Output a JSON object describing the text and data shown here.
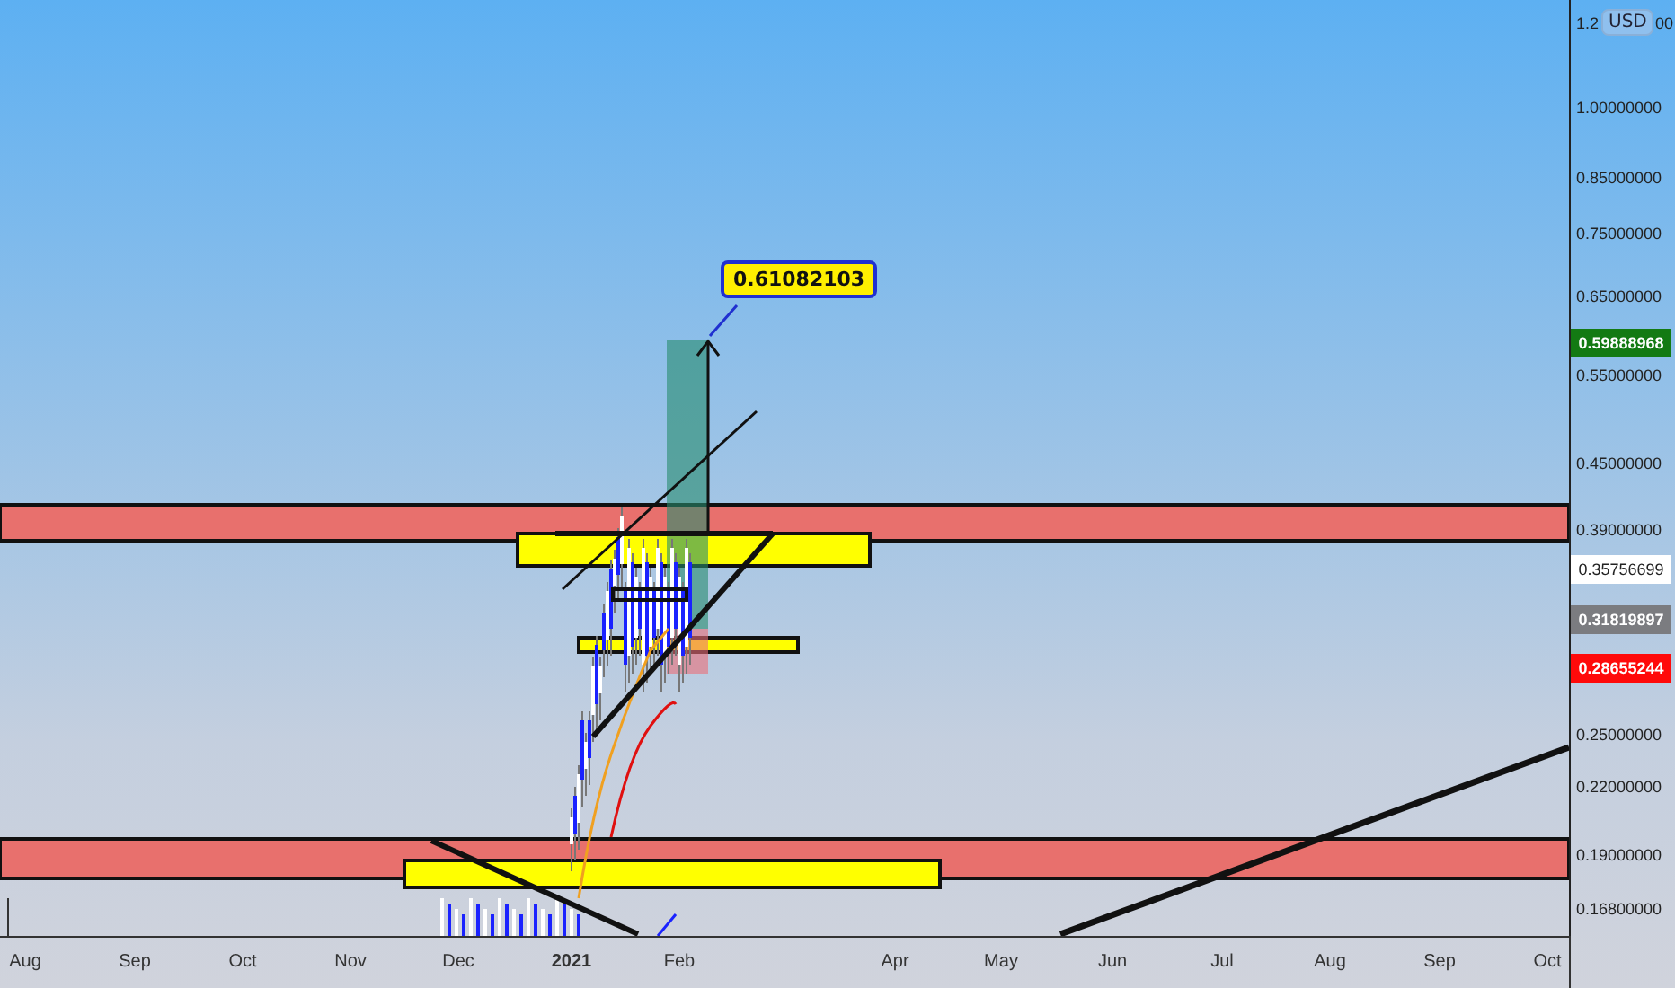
{
  "chart": {
    "target_callout": "0.61082103"
  },
  "price_axis": {
    "currency": "USD",
    "top_tick_parts": [
      "1.2",
      "00"
    ],
    "ticks": [
      "1.00000000",
      "0.85000000",
      "0.75000000",
      "0.65000000",
      "0.55000000",
      "0.45000000",
      "0.39000000",
      "0.25000000",
      "0.22000000",
      "0.19000000",
      "0.16800000"
    ],
    "labels": [
      {
        "text": "0.59888968",
        "kind": "target"
      },
      {
        "text": "0.35756699",
        "kind": "last"
      },
      {
        "text": "0.31819897",
        "kind": "entry"
      },
      {
        "text": "0.28655244",
        "kind": "stop"
      }
    ]
  },
  "time_axis": {
    "labels": [
      {
        "text": "Aug",
        "bold": false
      },
      {
        "text": "Sep",
        "bold": false
      },
      {
        "text": "Oct",
        "bold": false
      },
      {
        "text": "Nov",
        "bold": false
      },
      {
        "text": "Dec",
        "bold": false
      },
      {
        "text": "2021",
        "bold": true
      },
      {
        "text": "Feb",
        "bold": false
      },
      {
        "text": "Apr",
        "bold": false
      },
      {
        "text": "May",
        "bold": false
      },
      {
        "text": "Jun",
        "bold": false
      },
      {
        "text": "Jul",
        "bold": false
      },
      {
        "text": "Aug",
        "bold": false
      },
      {
        "text": "Sep",
        "bold": false
      },
      {
        "text": "Oct",
        "bold": false
      }
    ]
  }
}
